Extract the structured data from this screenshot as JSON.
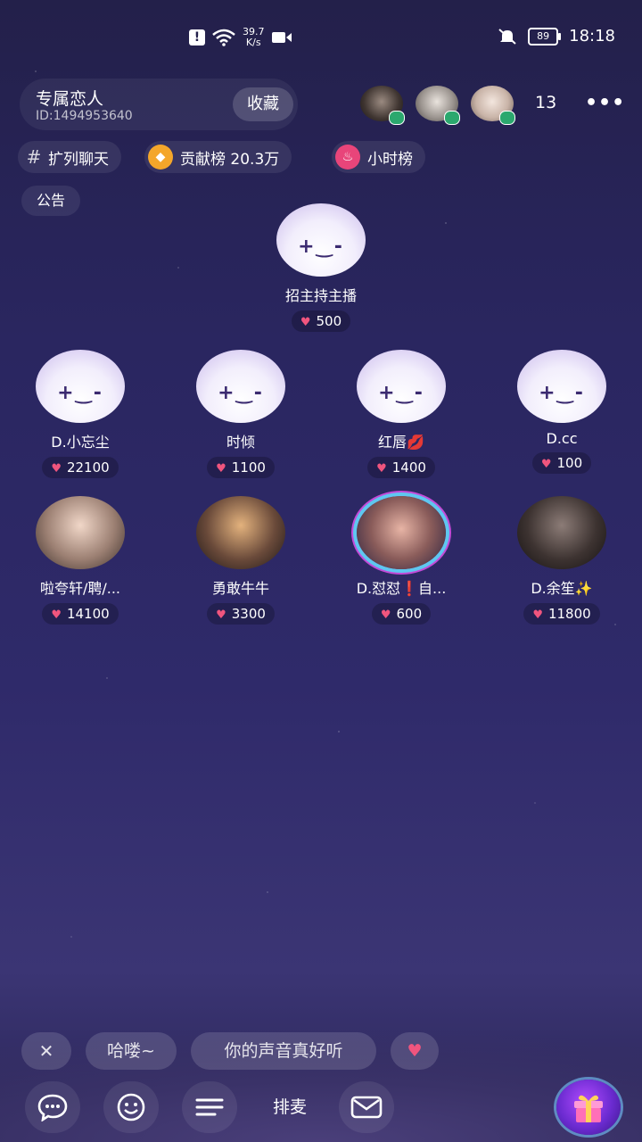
{
  "status_bar": {
    "speed_value": "39.7",
    "speed_unit": "K/s",
    "battery": "89",
    "time": "18:18"
  },
  "room": {
    "name": "专属恋人",
    "id_text": "ID:1494953640",
    "favorite_label": "收藏",
    "viewer_count": "13"
  },
  "tags": {
    "channel": "扩列聊天",
    "contribution_label": "贡献榜",
    "contribution_value": "20.3万",
    "hourly_label": "小时榜",
    "notice_label": "公告"
  },
  "host": {
    "name": "招主持主播",
    "score": "500"
  },
  "seats": [
    {
      "name": "D.小忘尘",
      "score": "22100"
    },
    {
      "name": "时倾",
      "score": "1100"
    },
    {
      "name": "红唇💋",
      "score": "1400"
    },
    {
      "name": "D.cc",
      "score": "100"
    },
    {
      "name": "啦夸轩/聘/...",
      "score": "14100"
    },
    {
      "name": "勇敢牛牛",
      "score": "3300"
    },
    {
      "name": "D.怼怼❗自...",
      "score": "600"
    },
    {
      "name": "D.余笙✨",
      "score": "11800"
    }
  ],
  "quick_replies": [
    "哈喽~",
    "你的声音真好听"
  ],
  "bottom_bar": {
    "queue_label": "排麦"
  },
  "colors": {
    "background": "#2b2760",
    "heart": "#f0557e",
    "contribution_icon": "#f4a62a",
    "hourly_icon": "#e8457a"
  }
}
